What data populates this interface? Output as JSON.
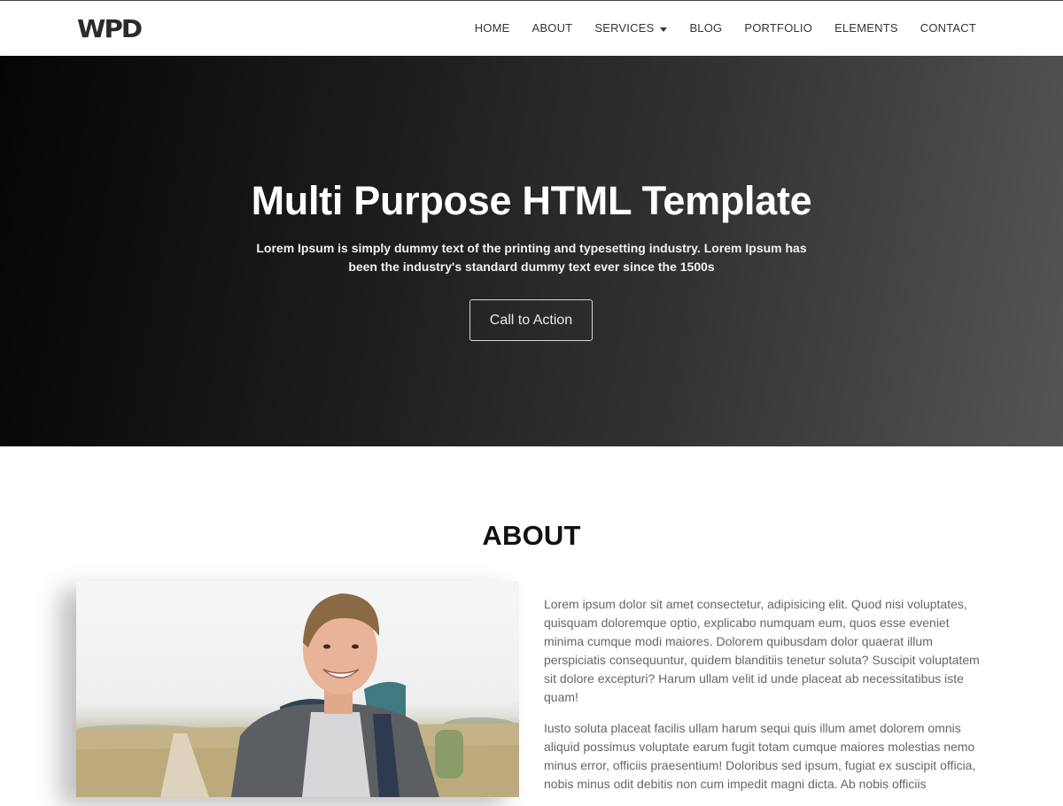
{
  "brand": {
    "logo_text": "WPD"
  },
  "nav": {
    "items": [
      {
        "label": "HOME"
      },
      {
        "label": "ABOUT"
      },
      {
        "label": "SERVICES",
        "has_dropdown": true
      },
      {
        "label": "BLOG"
      },
      {
        "label": "PORTFOLIO"
      },
      {
        "label": "ELEMENTS"
      },
      {
        "label": "CONTACT"
      }
    ]
  },
  "hero": {
    "title": "Multi Purpose HTML Template",
    "subtitle": "Lorem Ipsum is simply dummy text of the printing and typesetting industry. Lorem Ipsum has been the industry's standard dummy text ever since the 1500s",
    "cta_label": "Call to Action"
  },
  "about": {
    "title": "ABOUT",
    "paragraphs": [
      "Lorem ipsum dolor sit amet consectetur, adipisicing elit. Quod nisi voluptates, quisquam doloremque optio, explicabo numquam eum, quos esse eveniet minima cumque modi maiores. Dolorem quibusdam dolor quaerat illum perspiciatis consequuntur, quidem blanditiis tenetur soluta? Suscipit voluptatem sit dolore excepturi? Harum ullam velit id unde placeat ab necessitatibus iste quam!",
      "Iusto soluta placeat facilis ullam harum sequi quis illum amet dolorem omnis aliquid possimus voluptate earum fugit totam cumque maiores molestias nemo minus error, officiis praesentium! Doloribus sed ipsum, fugiat ex suscipit officia, nobis minus odit debitis non cum impedit magni dicta. Ab nobis officiis"
    ]
  },
  "colors": {
    "hero_dark": "#050505",
    "hero_light": "#555555",
    "text_muted": "#666666"
  }
}
